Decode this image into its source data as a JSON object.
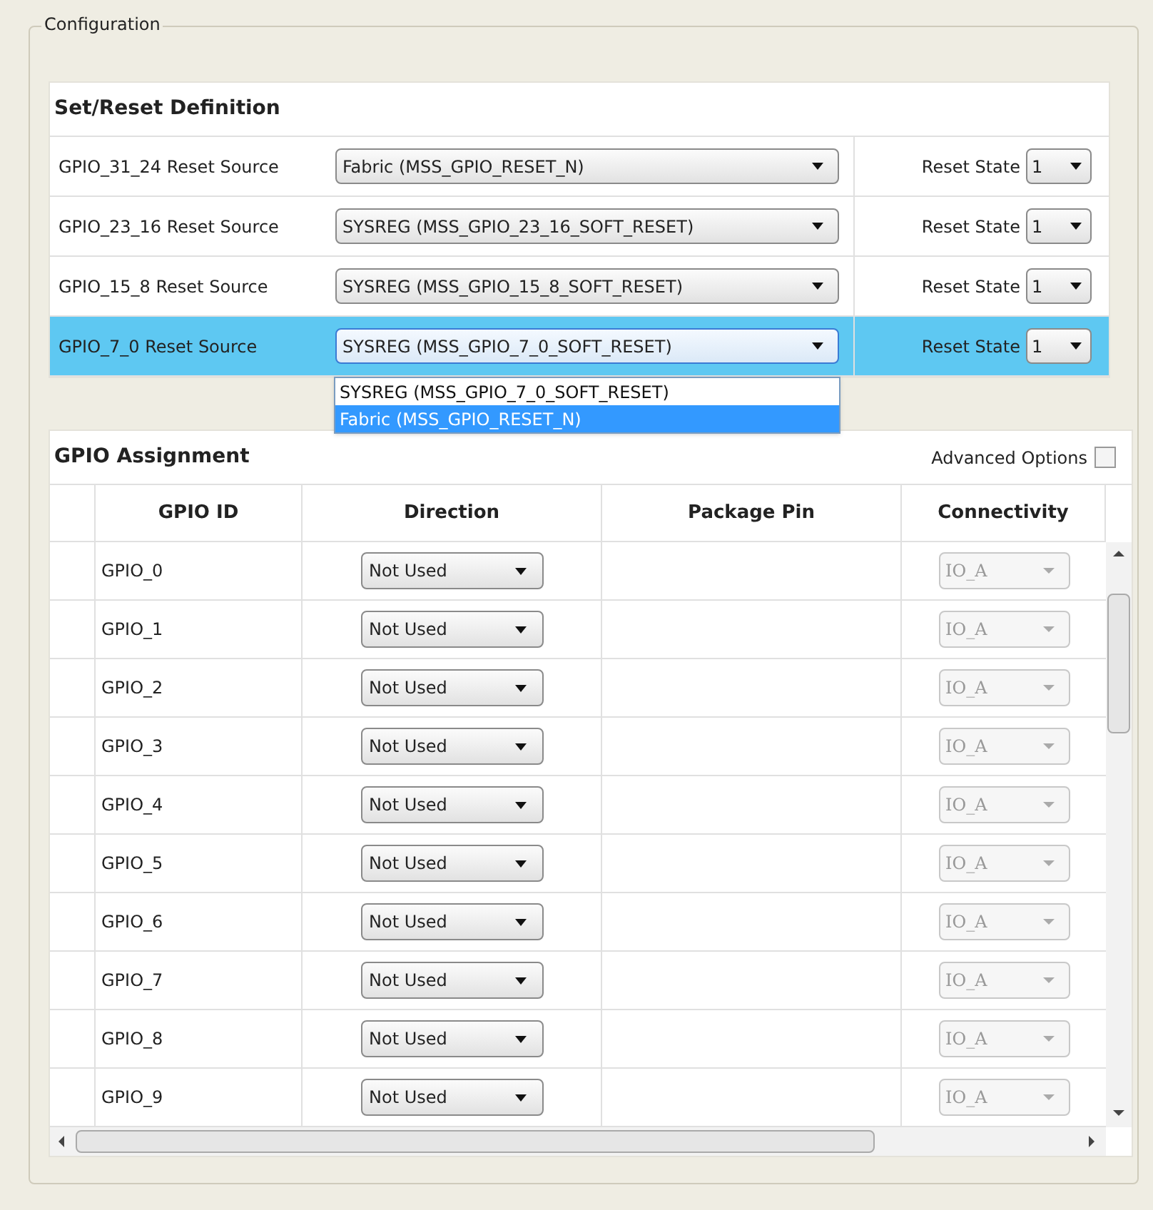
{
  "group_title": "Configuration",
  "set_reset": {
    "title": "Set/Reset Definition",
    "rows": [
      {
        "label": "GPIO_31_24 Reset Source",
        "source": "Fabric (MSS_GPIO_RESET_N)",
        "state_label": "Reset State",
        "state": "1",
        "selected": false
      },
      {
        "label": "GPIO_23_16 Reset Source",
        "source": "SYSREG (MSS_GPIO_23_16_SOFT_RESET)",
        "state_label": "Reset State",
        "state": "1",
        "selected": false
      },
      {
        "label": "GPIO_15_8 Reset Source",
        "source": "SYSREG (MSS_GPIO_15_8_SOFT_RESET)",
        "state_label": "Reset State",
        "state": "1",
        "selected": false
      },
      {
        "label": "GPIO_7_0 Reset Source",
        "source": "SYSREG (MSS_GPIO_7_0_SOFT_RESET)",
        "state_label": "Reset State",
        "state": "1",
        "selected": true
      }
    ],
    "open_dropdown": {
      "options": [
        {
          "label": "SYSREG (MSS_GPIO_7_0_SOFT_RESET)",
          "selected": false
        },
        {
          "label": "Fabric (MSS_GPIO_RESET_N)",
          "selected": true
        }
      ]
    }
  },
  "gpio": {
    "title": "GPIO Assignment",
    "advanced_options": {
      "label": "Advanced Options",
      "checked": false
    },
    "columns": [
      "GPIO ID",
      "Direction",
      "Package Pin",
      "Connectivity"
    ],
    "rows": [
      {
        "id": "GPIO_0",
        "direction": "Not Used",
        "connectivity": "IO_A",
        "connectivity_disabled": true
      },
      {
        "id": "GPIO_1",
        "direction": "Not Used",
        "connectivity": "IO_A",
        "connectivity_disabled": true
      },
      {
        "id": "GPIO_2",
        "direction": "Not Used",
        "connectivity": "IO_A",
        "connectivity_disabled": true
      },
      {
        "id": "GPIO_3",
        "direction": "Not Used",
        "connectivity": "IO_A",
        "connectivity_disabled": true
      },
      {
        "id": "GPIO_4",
        "direction": "Not Used",
        "connectivity": "IO_A",
        "connectivity_disabled": true
      },
      {
        "id": "GPIO_5",
        "direction": "Not Used",
        "connectivity": "IO_A",
        "connectivity_disabled": true
      },
      {
        "id": "GPIO_6",
        "direction": "Not Used",
        "connectivity": "IO_A",
        "connectivity_disabled": true
      },
      {
        "id": "GPIO_7",
        "direction": "Not Used",
        "connectivity": "IO_A",
        "connectivity_disabled": true
      },
      {
        "id": "GPIO_8",
        "direction": "Not Used",
        "connectivity": "IO_A",
        "connectivity_disabled": true
      },
      {
        "id": "GPIO_9",
        "direction": "Not Used",
        "connectivity": "IO_A",
        "connectivity_disabled": true
      }
    ]
  }
}
